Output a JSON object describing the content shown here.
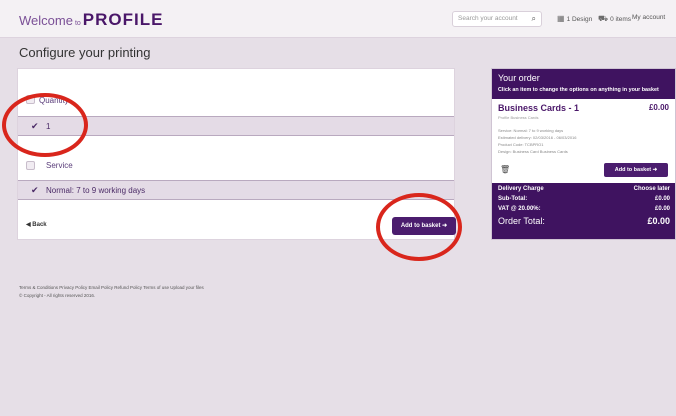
{
  "header": {
    "welcome": "Welcome",
    "to": "to",
    "brand": "PROFILE",
    "search_placeholder": "Search your account",
    "designs": "1 Design",
    "items": "0 items",
    "account": "My account"
  },
  "page_title": "Configure your printing",
  "quantity": {
    "label": "Quantity",
    "selected": "1"
  },
  "service": {
    "label": "Service",
    "selected": "Normal: 7 to 9 working days"
  },
  "back_label": "Back",
  "add_to_basket": "Add to basket",
  "order": {
    "title": "Your order",
    "subtitle": "Click an item to change the options on anything in your basket",
    "item_name": "Business Cards - 1",
    "item_price": "£0.00",
    "item_sub": "Profile Business Cards",
    "details": [
      "Service: Normal: 7 to 9 working days",
      "Estimated delivery: 02/03/2016 - 06/03/2016",
      "Product Code: TCBPRO1",
      "Design: Business Card Business Cards"
    ],
    "add_to_basket": "Add to basket",
    "delivery_label": "Delivery Charge",
    "delivery_value": "Choose later",
    "subtotal_label": "Sub-Total:",
    "subtotal_value": "£0.00",
    "vat_label": "VAT @ 20.00%:",
    "vat_value": "£0.00",
    "total_label": "Order Total:",
    "total_value": "£0.00"
  },
  "footer": {
    "links": "Terms & Conditions  Privacy Policy  Email Policy  Refund Policy  Terms of use  Upload your files",
    "copyright": "© Copyright - All rights reserved 2016."
  },
  "colors": {
    "brand_purple": "#4b1d6e",
    "annotation_red": "#d9261c"
  },
  "icons": {
    "search": "search-icon",
    "design": "design-icon",
    "cart": "cart-icon",
    "check": "check-icon",
    "trash": "trash-icon",
    "back": "back-arrow-icon"
  }
}
